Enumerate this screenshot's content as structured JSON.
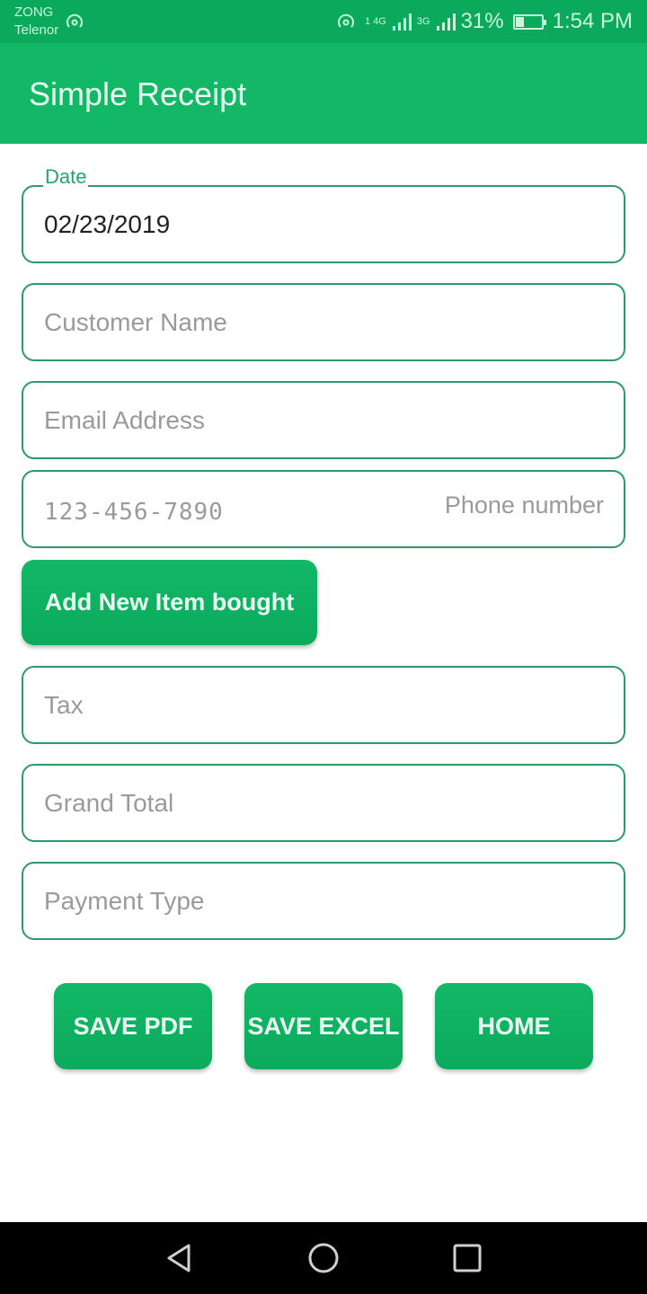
{
  "status_bar": {
    "carrier_1": "ZONG",
    "carrier_2": "Telenor",
    "sim1_sup": "1",
    "sim1_net": "4G",
    "sim1_sub": "1",
    "sim2_net": "3G",
    "battery_percent": "31%",
    "battery_level": 0.31,
    "time": "1:54 PM",
    "icons": [
      "hotspot-icon",
      "signal-icon",
      "signal-icon",
      "battery-charging-icon"
    ]
  },
  "app_bar": {
    "title": "Simple Receipt"
  },
  "form": {
    "date": {
      "label": "Date",
      "value": "02/23/2019"
    },
    "customer_name": {
      "placeholder": "Customer Name"
    },
    "email": {
      "placeholder": "Email Address"
    },
    "phone": {
      "placeholder": "123-456-7890",
      "hint": "Phone number"
    },
    "add_item_label": "Add New Item bought",
    "tax": {
      "placeholder": "Tax"
    },
    "grand_total": {
      "placeholder": "Grand Total"
    },
    "payment_type": {
      "placeholder": "Payment Type"
    }
  },
  "actions": {
    "save_pdf": "SAVE PDF",
    "save_excel": "SAVE EXCEL",
    "home": "HOME"
  },
  "nav": {
    "icons": [
      "back-icon",
      "home-icon",
      "recents-icon"
    ]
  },
  "colors": {
    "primary": "#12b866",
    "status_bar": "#0aa95b",
    "field_border": "#2e9a6c",
    "label": "#26a46b"
  }
}
